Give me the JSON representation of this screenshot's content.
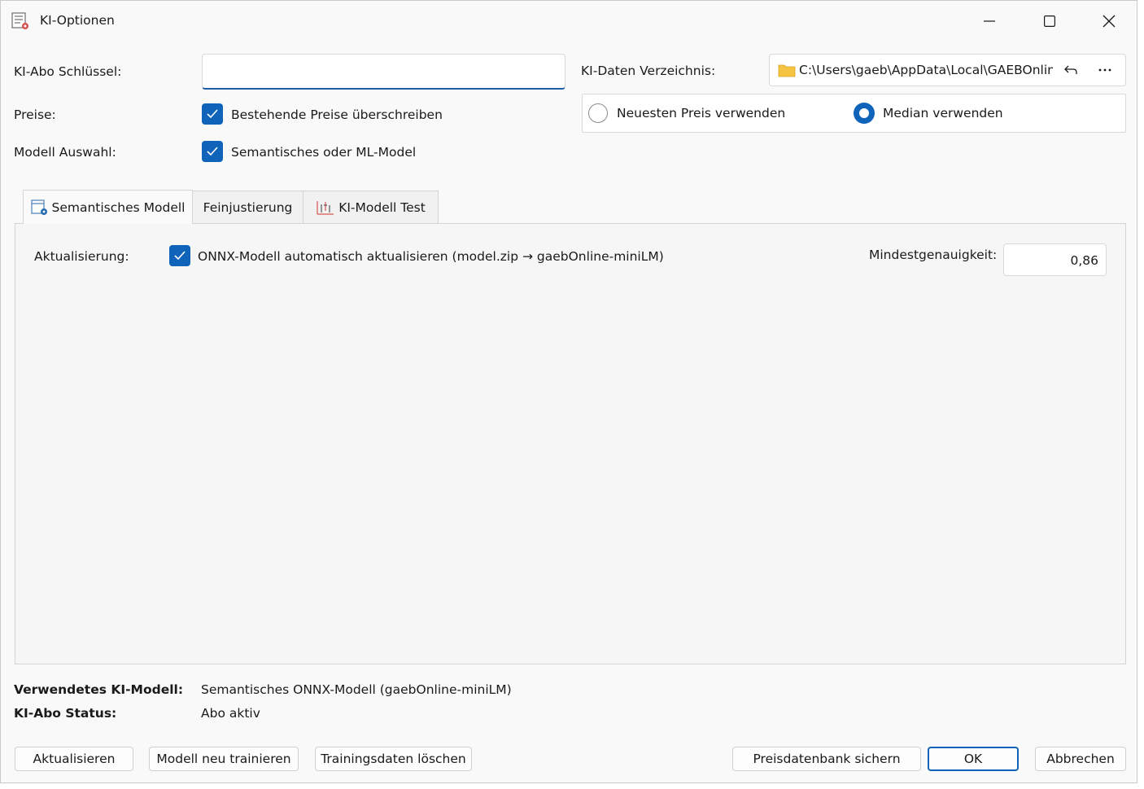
{
  "window": {
    "title": "KI-Optionen",
    "app_icon": "settings-list-icon"
  },
  "caption_buttons": {
    "minimize": "minimize-icon",
    "maximize": "maximize-icon",
    "close": "close-icon"
  },
  "form": {
    "abo_key_label": "KI-Abo Schlüssel:",
    "abo_key_value": "",
    "data_dir_label": "KI-Daten Verzeichnis:",
    "data_dir_value": "C:\\Users\\gaeb\\AppData\\Local\\GAEBOnline\\I",
    "prices_label": "Preise:",
    "prices_checkbox_label": "Bestehende Preise überschreiben",
    "prices_checked": true,
    "model_label": "Modell Auswahl:",
    "model_checkbox_label": "Semantisches oder ML-Model",
    "model_checked": true,
    "radio_newest_label": "Neuesten Preis verwenden",
    "radio_median_label": "Median verwenden",
    "radio_selected": "median"
  },
  "tabs": [
    {
      "label": "Semantisches Modell",
      "icon": "model-settings-icon",
      "active": true
    },
    {
      "label": "Feinjustierung",
      "active": false
    },
    {
      "label": "KI-Modell Test",
      "icon": "chart-icon",
      "active": false
    }
  ],
  "tab_panel": {
    "update_label": "Aktualisierung:",
    "update_checkbox_label": "ONNX-Modell automatisch aktualisieren (model.zip → gaebOnline-miniLM)",
    "update_checked": true,
    "min_accuracy_label": "Mindestgenauigkeit:",
    "min_accuracy_value": "0,86"
  },
  "status": {
    "used_model_label": "Verwendetes KI-Modell:",
    "used_model_value": "Semantisches ONNX-Modell (gaebOnline-miniLM)",
    "abo_status_label": "KI-Abo Status:",
    "abo_status_value": "Abo aktiv"
  },
  "buttons": {
    "refresh": "Aktualisieren",
    "retrain": "Modell neu trainieren",
    "delete_training": "Trainingsdaten löschen",
    "backup_db": "Preisdatenbank sichern",
    "ok": "OK",
    "cancel": "Abbrechen"
  },
  "colors": {
    "accent": "#0f63b8",
    "folder": "#f6c343"
  }
}
